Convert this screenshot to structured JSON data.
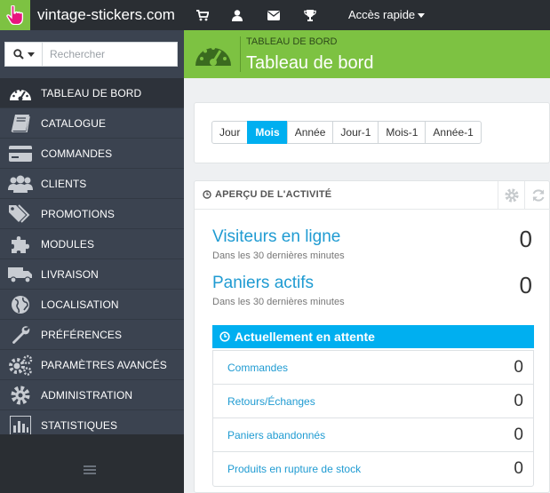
{
  "topbar": {
    "shop_name": "vintage-stickers.com",
    "icons": [
      "cart-icon",
      "user-icon",
      "envelope-icon",
      "trophy-icon"
    ],
    "quick_access": "Accès rapide"
  },
  "search": {
    "placeholder": "Rechercher"
  },
  "sidebar": {
    "items": [
      {
        "label": "TABLEAU DE BORD",
        "icon": "dashboard-icon",
        "active": true
      },
      {
        "label": "CATALOGUE",
        "icon": "book-icon"
      },
      {
        "label": "COMMANDES",
        "icon": "credit-card-icon"
      },
      {
        "label": "CLIENTS",
        "icon": "users-icon"
      },
      {
        "label": "PROMOTIONS",
        "icon": "tags-icon"
      },
      {
        "label": "MODULES",
        "icon": "puzzle-icon"
      },
      {
        "label": "LIVRAISON",
        "icon": "truck-icon"
      },
      {
        "label": "LOCALISATION",
        "icon": "globe-icon"
      },
      {
        "label": "PRÉFÉRENCES",
        "icon": "wrench-icon"
      },
      {
        "label": "PARAMÈTRES AVANCÉS",
        "icon": "gears-icon"
      },
      {
        "label": "ADMINISTRATION",
        "icon": "gear-icon"
      },
      {
        "label": "STATISTIQUES",
        "icon": "bar-chart-icon"
      }
    ]
  },
  "header": {
    "breadcrumb": "TABLEAU DE BORD",
    "title": "Tableau de bord"
  },
  "periods": {
    "buttons": [
      "Jour",
      "Mois",
      "Année",
      "Jour-1",
      "Mois-1",
      "Année-1"
    ],
    "active": "Mois"
  },
  "activity": {
    "title": "APERÇU DE L'ACTIVITÉ",
    "visitors": {
      "label": "Visiteurs en ligne",
      "sub": "Dans les 30 dernières minutes",
      "value": "0"
    },
    "carts": {
      "label": "Paniers actifs",
      "sub": "Dans les 30 dernières minutes",
      "value": "0"
    },
    "pending": {
      "title": "Actuellement en attente",
      "rows": [
        {
          "label": "Commandes",
          "value": "0"
        },
        {
          "label": "Retours/Échanges",
          "value": "0"
        },
        {
          "label": "Paniers abandonnés",
          "value": "0"
        },
        {
          "label": "Produits en rupture de stock",
          "value": "0"
        }
      ]
    }
  },
  "colors": {
    "brand_green": "#7dc242",
    "accent_blue": "#00aff0",
    "link_blue": "#1f9bd2",
    "sidebar": "#3b4350",
    "topbar": "#2a2e33"
  }
}
